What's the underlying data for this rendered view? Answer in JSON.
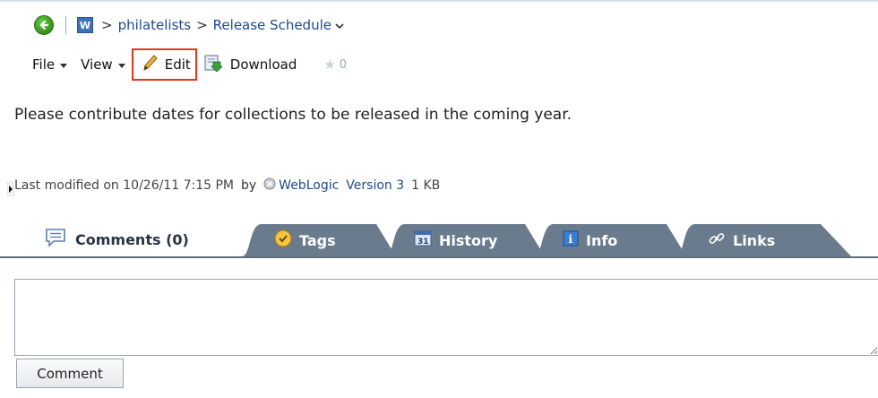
{
  "breadcrumb": {
    "separator": ">",
    "items": [
      "philatelists",
      "Release Schedule"
    ],
    "app_icon_letter": "W"
  },
  "toolbar": {
    "file_label": "File",
    "view_label": "View",
    "edit_label": "Edit",
    "download_label": "Download",
    "rating_count": "0"
  },
  "description": "Please contribute dates for collections to be released in the coming year.",
  "meta": {
    "modified_text": "Last modified on 10/26/11 7:15 PM",
    "by_label": "by",
    "user": "WebLogic",
    "version": "Version 3",
    "size": "1 KB"
  },
  "tabs": [
    {
      "label": "Comments (0)",
      "icon": "comment-icon",
      "active": true
    },
    {
      "label": "Tags",
      "icon": "tag-icon",
      "active": false
    },
    {
      "label": "History",
      "icon": "history-icon",
      "active": false
    },
    {
      "label": "Info",
      "icon": "info-icon",
      "active": false
    },
    {
      "label": "Links",
      "icon": "link-icon",
      "active": false
    }
  ],
  "comment": {
    "input_value": "",
    "button_label": "Comment"
  },
  "colors": {
    "link": "#1d4c8a",
    "edit_highlight": "#e1381b",
    "tab_fill": "#6a7b8e"
  }
}
